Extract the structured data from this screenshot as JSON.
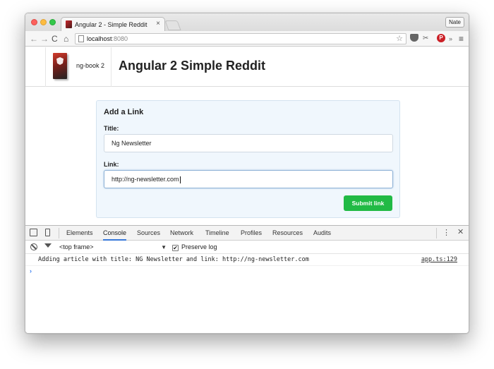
{
  "browser": {
    "tab_title": "Angular 2 - Simple Reddit",
    "tab_close": "×",
    "profile": "Nate",
    "url_host": "localhost",
    "url_port": ":8080",
    "nav": {
      "back": "←",
      "forward": "→",
      "reload": "C",
      "home": "⌂"
    },
    "star": "☆",
    "ext_tool": "✂",
    "ext_pin": "P",
    "ext_more": "»",
    "menu": "≡"
  },
  "site": {
    "logo_text": "ng-book 2",
    "title": "Angular 2 Simple Reddit"
  },
  "form": {
    "heading": "Add a Link",
    "title_label": "Title:",
    "title_value": "Ng Newsletter",
    "link_label": "Link:",
    "link_value": "http://ng-newsletter.com",
    "submit_label": "Submit link"
  },
  "devtools": {
    "tabs": [
      "Elements",
      "Console",
      "Sources",
      "Network",
      "Timeline",
      "Profiles",
      "Resources",
      "Audits"
    ],
    "active_tab": "Console",
    "kebab": "⋮",
    "close": "✕",
    "frame": "<top frame>",
    "frame_arrow": "▼",
    "preserve_log": "Preserve log",
    "preserve_checked": "✔",
    "console": [
      {
        "message": "Adding article with title: NG Newsletter and link: http://ng-newsletter.com",
        "source": "app.ts:129"
      }
    ],
    "prompt": "›"
  },
  "colors": {
    "submit_green": "#21ba45",
    "form_bg": "#f0f7fd",
    "active_tab_underline": "#3879d9",
    "prompt_blue": "#367cf1"
  }
}
